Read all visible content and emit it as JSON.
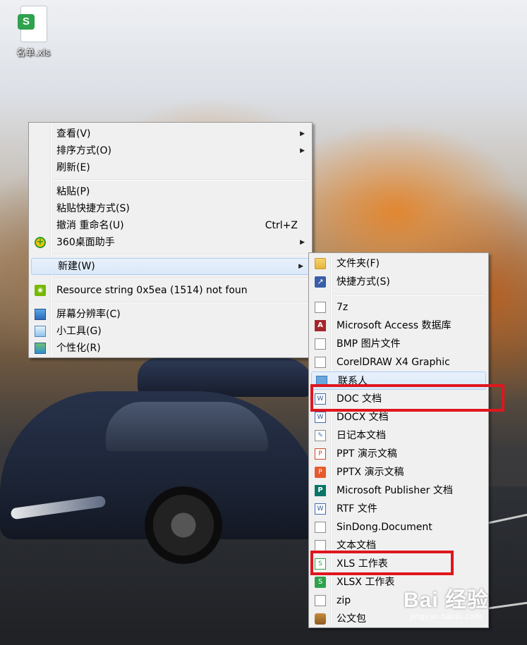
{
  "desktop": {
    "file_icon_label": "名单.xls",
    "file_icon_badge": "S"
  },
  "context_menu": {
    "items": [
      {
        "label": "查看(V)",
        "submenu": true
      },
      {
        "label": "排序方式(O)",
        "submenu": true
      },
      {
        "label": "刷新(E)"
      },
      {
        "label": "粘贴(P)"
      },
      {
        "label": "粘贴快捷方式(S)"
      },
      {
        "label": "撤消 重命名(U)",
        "shortcut": "Ctrl+Z"
      },
      {
        "label": "360桌面助手",
        "icon": "360-icon",
        "submenu": true
      },
      {
        "label": "新建(W)",
        "submenu": true,
        "highlighted": true
      },
      {
        "label": "Resource string 0x5ea (1514) not foun",
        "icon": "nvidia-icon"
      },
      {
        "label": "屏幕分辨率(C)",
        "icon": "monitor-icon"
      },
      {
        "label": "小工具(G)",
        "icon": "gadget-icon"
      },
      {
        "label": "个性化(R)",
        "icon": "personalize-icon"
      }
    ]
  },
  "new_submenu": {
    "items": [
      {
        "label": "文件夹(F)",
        "icon": "folder-icon"
      },
      {
        "label": "快捷方式(S)",
        "icon": "shortcut-icon"
      },
      {
        "label": "7z",
        "icon": "generic-file-icon"
      },
      {
        "label": "Microsoft Access 数据库",
        "icon": "access-icon"
      },
      {
        "label": "BMP 图片文件",
        "icon": "generic-file-icon"
      },
      {
        "label": "CorelDRAW X4 Graphic",
        "icon": "generic-file-icon"
      },
      {
        "label": "联系人",
        "icon": "contact-icon",
        "highlighted": true
      },
      {
        "label": "DOC 文档",
        "icon": "word-doc-icon"
      },
      {
        "label": "DOCX 文档",
        "icon": "word-docx-icon"
      },
      {
        "label": "日记本文档",
        "icon": "journal-icon"
      },
      {
        "label": "PPT 演示文稿",
        "icon": "ppt-icon"
      },
      {
        "label": "PPTX 演示文稿",
        "icon": "pptx-icon"
      },
      {
        "label": "Microsoft Publisher 文档",
        "icon": "publisher-icon"
      },
      {
        "label": "RTF 文件",
        "icon": "rtf-icon"
      },
      {
        "label": "SinDong.Document",
        "icon": "generic-file-icon"
      },
      {
        "label": "文本文档",
        "icon": "text-file-icon"
      },
      {
        "label": "XLS 工作表",
        "icon": "xls-icon"
      },
      {
        "label": "XLSX 工作表",
        "icon": "xlsx-icon"
      },
      {
        "label": "zip",
        "icon": "generic-file-icon"
      },
      {
        "label": "公文包",
        "icon": "briefcase-icon"
      }
    ]
  },
  "annotations": {
    "color": "#e0161e",
    "highlighted_items": [
      "DOC 文档",
      "XLS 工作表"
    ]
  },
  "watermark": {
    "main": "Bai 经验",
    "url": "jingyan.baidu.com"
  }
}
